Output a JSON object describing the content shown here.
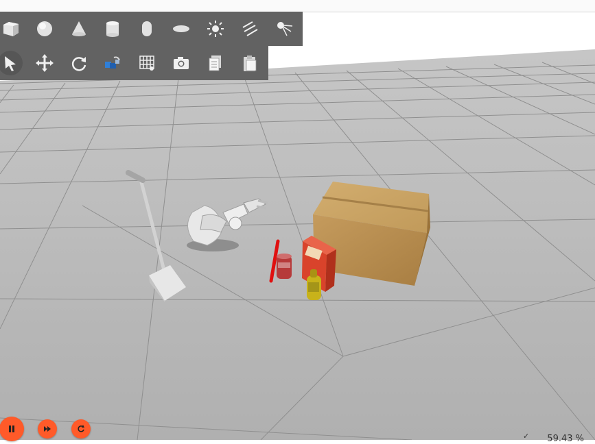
{
  "shapes_toolbar": {
    "items": [
      {
        "name": "box-icon"
      },
      {
        "name": "sphere-icon"
      },
      {
        "name": "cone-icon"
      },
      {
        "name": "cylinder-icon"
      },
      {
        "name": "capsule-icon"
      },
      {
        "name": "ellipsoid-icon"
      },
      {
        "name": "point-light-icon"
      },
      {
        "name": "directional-light-icon"
      },
      {
        "name": "spot-light-icon"
      }
    ]
  },
  "tools_toolbar": {
    "items": [
      {
        "name": "select-arrow-icon",
        "active": true
      },
      {
        "name": "translate-icon"
      },
      {
        "name": "rotate-icon"
      },
      {
        "name": "align-icon"
      },
      {
        "name": "grid-snap-icon"
      },
      {
        "name": "camera-screenshot-icon"
      },
      {
        "name": "copy-icon"
      },
      {
        "name": "paste-icon"
      }
    ]
  },
  "controls": {
    "pause_color": "#ff5a29",
    "step_color": "#ff5a29",
    "reset_color": "#ff5a29"
  },
  "stats": {
    "real_time_factor": "59.43 %",
    "check_mark": "✓"
  },
  "scene_colors": {
    "ground": "#b5b5b5",
    "grid_line": "#8e8e8e",
    "sky": "#ffffff",
    "cardboard_box": "#c49a5a",
    "cracker_box": "#d9432b",
    "mustard": "#c8b21a",
    "can": "#b63a3a",
    "red_rod": "#e01010"
  }
}
